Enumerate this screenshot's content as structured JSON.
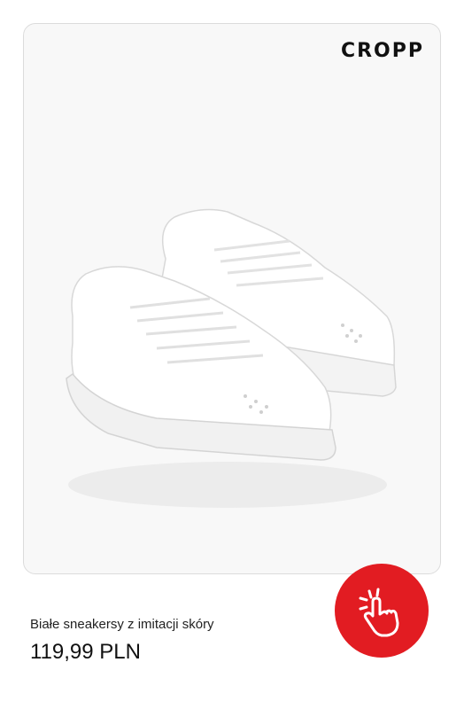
{
  "brand": {
    "logo_text": "CROPP"
  },
  "product": {
    "name": "Białe sneakersy z imitacji skóry",
    "price": "119,99 PLN",
    "image_icon": "white-sneakers-image"
  },
  "cta": {
    "icon": "tap-hand-icon",
    "color": "#e21c22"
  },
  "colors": {
    "accent": "#e21c22",
    "card_background": "#f8f8f8",
    "text": "#111111"
  }
}
